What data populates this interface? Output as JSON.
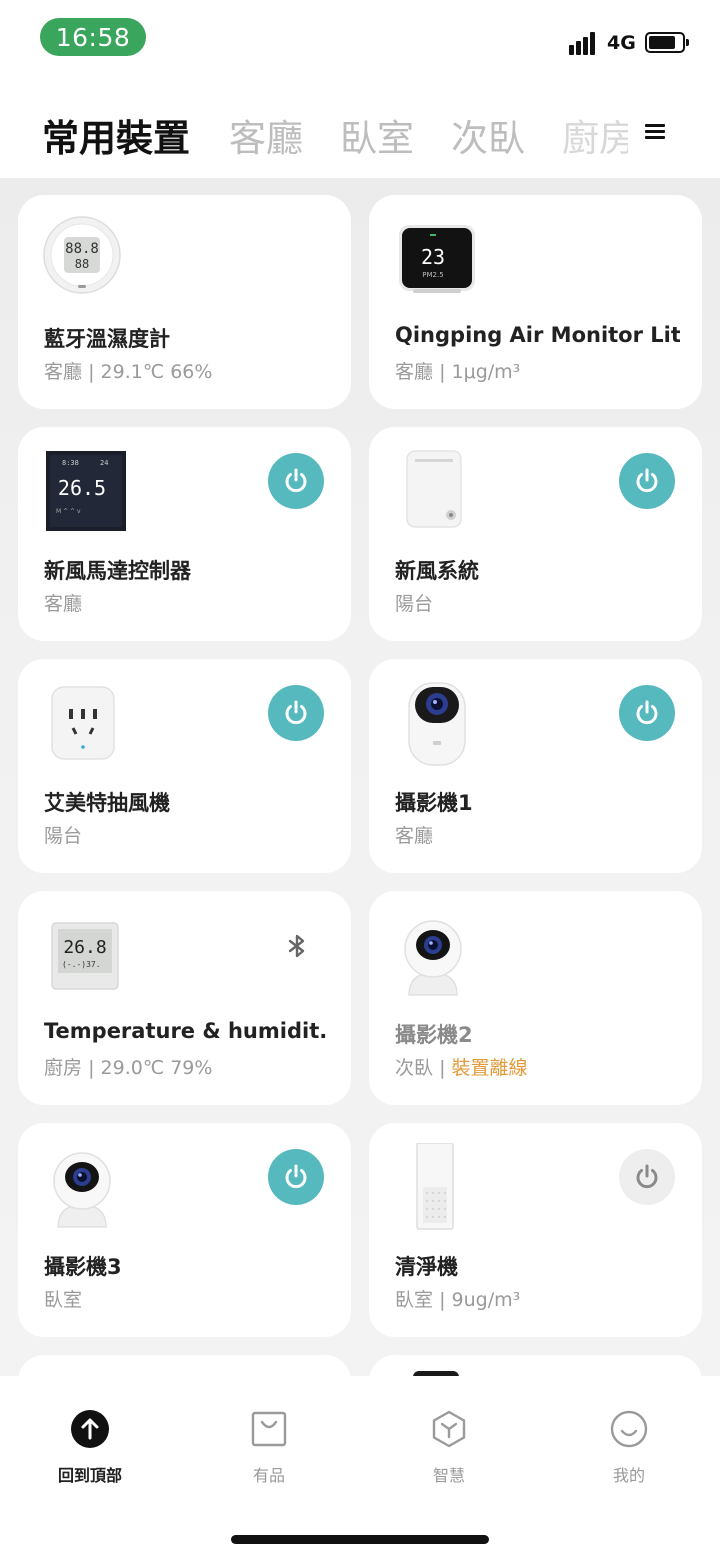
{
  "status_bar": {
    "time": "16:58",
    "network": "4G"
  },
  "tabs": [
    {
      "label": "常用裝置",
      "active": true
    },
    {
      "label": "客廳",
      "active": false
    },
    {
      "label": "臥室",
      "active": false
    },
    {
      "label": "次臥",
      "active": false
    },
    {
      "label": "廚房",
      "active": false
    }
  ],
  "devices": [
    {
      "name": "藍牙溫濕度計",
      "room": "客廳",
      "status": "29.1℃ 66%",
      "icon": "thermometer-round-icon",
      "control": "none"
    },
    {
      "name": "Qingping Air Monitor Lite",
      "room": "客廳",
      "status": "1μg/m³",
      "icon": "air-monitor-icon",
      "control": "none",
      "display_value": "23",
      "display_unit": "PM2.5"
    },
    {
      "name": "新風馬達控制器",
      "room": "客廳",
      "status": "",
      "icon": "thermostat-panel-icon",
      "control": "power-on",
      "display_value": "26.5"
    },
    {
      "name": "新風系統",
      "room": "陽台",
      "status": "",
      "icon": "fresh-air-unit-icon",
      "control": "power-on"
    },
    {
      "name": "艾美特抽風機",
      "room": "陽台",
      "status": "",
      "icon": "smart-plug-icon",
      "control": "power-on"
    },
    {
      "name": "攝影機1",
      "room": "客廳",
      "status": "",
      "icon": "camera-pro-icon",
      "control": "power-on"
    },
    {
      "name": "Temperature & humidit...",
      "room": "廚房",
      "status": "29.0℃ 79%",
      "icon": "thermometer-square-icon",
      "control": "bluetooth",
      "display_value": "26.8"
    },
    {
      "name": "攝影機2",
      "room": "次臥",
      "status": "裝置離線",
      "icon": "camera-icon",
      "control": "none",
      "offline": true
    },
    {
      "name": "攝影機3",
      "room": "臥室",
      "status": "",
      "icon": "camera-icon",
      "control": "power-on"
    },
    {
      "name": "清淨機",
      "room": "臥室",
      "status": "9ug/m³",
      "icon": "air-purifier-icon",
      "control": "power-off"
    }
  ],
  "separator": "|",
  "bottom_nav": [
    {
      "label": "回到頂部",
      "icon": "arrow-up-icon",
      "active": true
    },
    {
      "label": "有品",
      "icon": "shopping-bag-icon",
      "active": false
    },
    {
      "label": "智慧",
      "icon": "smart-hexagon-icon",
      "active": false
    },
    {
      "label": "我的",
      "icon": "smile-icon",
      "active": false
    }
  ],
  "colors": {
    "accent": "#56b9bd",
    "status_pill": "#3aa55c",
    "offline": "#e39a3a"
  }
}
